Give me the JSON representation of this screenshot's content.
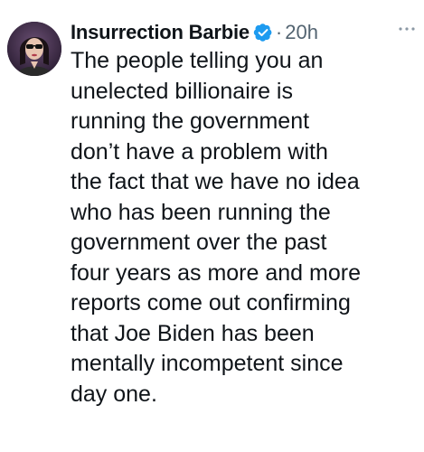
{
  "author": {
    "display_name": "Insurrection Barbie",
    "verified_icon": "verified-badge-icon",
    "separator": "·",
    "timestamp": "20h"
  },
  "more_icon": "more-options-icon",
  "tweet": {
    "text": "The people telling you an\nunelected billionaire is\nrunning the government\ndon’t have a problem with\nthe fact that we have no idea\nwho has been running the\ngovernment over the past\nfour years as more and more\nreports come out confirming\nthat Joe Biden has been\nmentally incompetent since\nday one."
  },
  "colors": {
    "verified_blue": "#1d9bf0",
    "secondary_text": "#536471",
    "primary_text": "#0f1419"
  }
}
